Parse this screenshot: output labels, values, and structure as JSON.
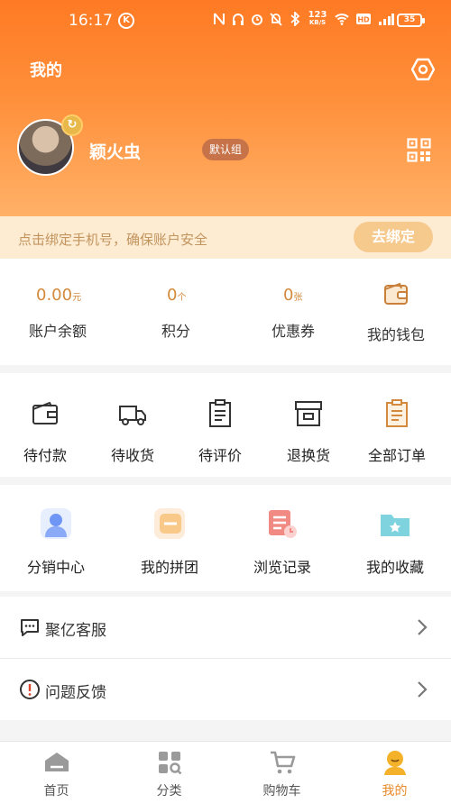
{
  "status_bar": {
    "time": "16:17",
    "k_icon": "K",
    "speed": "123",
    "speed_unit": "KB/S",
    "battery": "35"
  },
  "header": {
    "title": "我的"
  },
  "profile": {
    "username": "颖火虫",
    "group_badge": "默认组"
  },
  "bind_phone": {
    "text": "点击绑定手机号，确保账户安全",
    "button": "去绑定"
  },
  "assets": [
    {
      "value": "0.00",
      "unit": "元",
      "label": "账户余额"
    },
    {
      "value": "0",
      "unit": "个",
      "label": "积分"
    },
    {
      "value": "0",
      "unit": "张",
      "label": "优惠券"
    },
    {
      "label": "我的钱包",
      "icon": "wallet-icon"
    }
  ],
  "orders": [
    {
      "label": "待付款",
      "icon": "wallet-outline-icon"
    },
    {
      "label": "待收货",
      "icon": "truck-icon"
    },
    {
      "label": "待评价",
      "icon": "clipboard-icon"
    },
    {
      "label": "退换货",
      "icon": "return-box-icon"
    },
    {
      "label": "全部订单",
      "icon": "orders-list-icon"
    }
  ],
  "tools": [
    {
      "label": "分销中心",
      "icon": "distribution-icon"
    },
    {
      "label": "我的拼团",
      "icon": "group-buy-icon"
    },
    {
      "label": "浏览记录",
      "icon": "history-icon"
    },
    {
      "label": "我的收藏",
      "icon": "favorites-folder-icon"
    }
  ],
  "services": [
    {
      "label": "聚亿客服",
      "icon": "chat-icon"
    },
    {
      "label": "问题反馈",
      "icon": "alert-icon"
    }
  ],
  "tabbar": [
    {
      "label": "首页",
      "icon": "home-icon",
      "active": false
    },
    {
      "label": "分类",
      "icon": "category-icon",
      "active": false
    },
    {
      "label": "购物车",
      "icon": "cart-icon",
      "active": false
    },
    {
      "label": "我的",
      "icon": "profile-icon",
      "active": true
    }
  ],
  "colors": {
    "header_start": "#ff7a24",
    "accent": "#e88a2a",
    "bind_bg": "#fdebd2"
  }
}
